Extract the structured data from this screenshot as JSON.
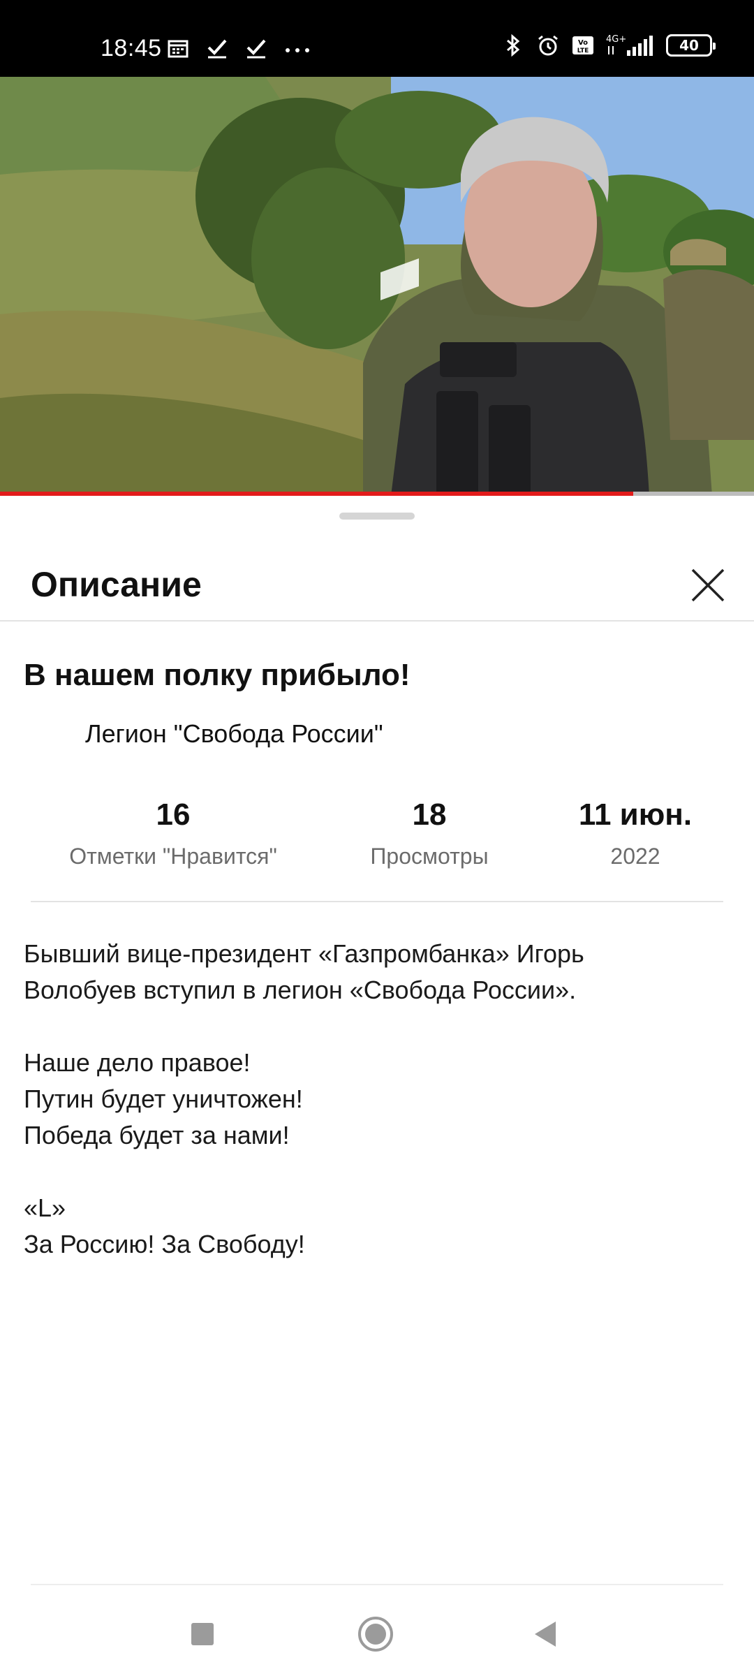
{
  "status_bar": {
    "time": "18:45",
    "left_icons": [
      "calendar-icon",
      "check-icon",
      "check-icon",
      "more-dots-icon"
    ],
    "right_icons": [
      "bluetooth-icon",
      "alarm-icon",
      "volte-icon",
      "signal-4g-icon",
      "battery-icon"
    ],
    "network": "4G+",
    "battery": "40"
  },
  "video": {
    "progress": 0.84,
    "progress_color": "#e21b1b"
  },
  "sheet": {
    "title": "Описание",
    "close_icon": "close-icon"
  },
  "post": {
    "title": "В нашем полку прибыло!",
    "channel": "Легион \"Свобода России\"",
    "stats": {
      "likes_value": "16",
      "likes_label": "Отметки \"Нравится\"",
      "views_value": "18",
      "views_label": "Просмотры",
      "date_value": "11 июн.",
      "date_year": "2022"
    },
    "description": [
      "Бывший вице-президент «Газпромбанка» Игорь",
      "Волобуев вступил в легион «Свобода России».",
      "",
      "Наше дело правое!",
      "Путин будет уничтожен!",
      "Победа будет за нами!",
      "",
      "«L»",
      "За Россию! За Свободу!"
    ]
  },
  "nav": {
    "recent_icon": "square-icon",
    "home_icon": "circle-icon",
    "back_icon": "triangle-back-icon"
  }
}
